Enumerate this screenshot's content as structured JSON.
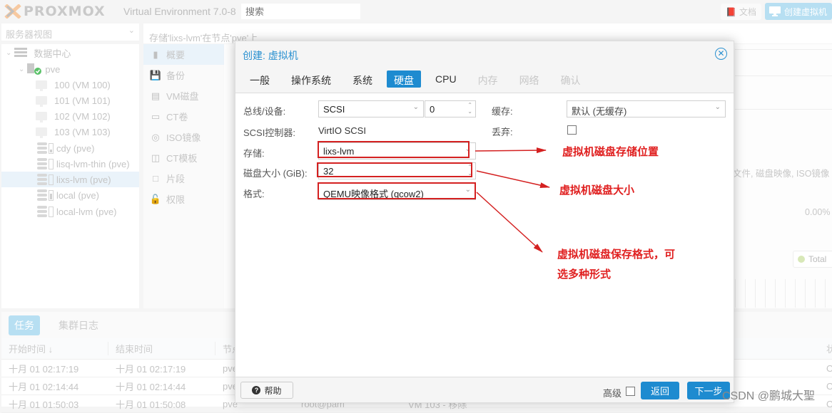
{
  "header": {
    "logo_text": "PROXMOX",
    "version": "Virtual Environment 7.0-8",
    "search_placeholder": "搜索",
    "docs_label": "文档",
    "create_vm_label": "创建虚拟机"
  },
  "tree": {
    "view_select": "服务器视图",
    "items": [
      {
        "label": "数据中心",
        "icon": "datacenter-icon"
      },
      {
        "label": "pve",
        "icon": "node-online-icon"
      },
      {
        "label": "100 (VM 100)",
        "icon": "vm-icon"
      },
      {
        "label": "101 (VM 101)",
        "icon": "vm-icon"
      },
      {
        "label": "102 (VM 102)",
        "icon": "vm-icon"
      },
      {
        "label": "103 (VM 103)",
        "icon": "vm-icon"
      },
      {
        "label": "cdy (pve)",
        "icon": "storage-icon",
        "usage": 0.3
      },
      {
        "label": "lisq-lvm-thin (pve)",
        "icon": "storage-icon",
        "usage": 0
      },
      {
        "label": "lixs-lvm (pve)",
        "icon": "storage-icon",
        "usage": 0,
        "selected": true
      },
      {
        "label": "local (pve)",
        "icon": "storage-icon",
        "usage": 0.6
      },
      {
        "label": "local-lvm (pve)",
        "icon": "storage-icon",
        "usage": 0
      }
    ]
  },
  "breadcrumb": "存储'lixs-lvm'在节点'pve'上",
  "subnav": [
    {
      "label": "概要",
      "icon": "book-icon",
      "active": true
    },
    {
      "label": "备份",
      "icon": "floppy-icon"
    },
    {
      "label": "VM磁盘",
      "icon": "hdd-icon"
    },
    {
      "label": "CT卷",
      "icon": "ct-volume-icon"
    },
    {
      "label": "ISO镜像",
      "icon": "cdrom-icon"
    },
    {
      "label": "CT模板",
      "icon": "ct-template-icon"
    },
    {
      "label": "片段",
      "icon": "snippet-file-icon"
    },
    {
      "label": "权限",
      "icon": "unlock-icon"
    }
  ],
  "background": {
    "content_text": "文件, 磁盘映像, ISO镜像",
    "usage_percent": "0.00%",
    "legend_total": "Total"
  },
  "tasks": {
    "tabs": [
      {
        "label": "任务",
        "active": true
      },
      {
        "label": "集群日志"
      }
    ],
    "columns": [
      "开始时间 ↓",
      "结束时间",
      "节点",
      "状态"
    ],
    "rows": [
      {
        "start": "十月 01 02:17:19",
        "end": "十月 01 02:17:19",
        "node": "pve",
        "status": "OK"
      },
      {
        "start": "十月 01 02:14:44",
        "end": "十月 01 02:14:44",
        "node": "pve",
        "status": "OK"
      },
      {
        "start": "十月 01 01:50:03",
        "end": "十月 01 01:50:08",
        "node": "pve",
        "user": "root@pam",
        "desc": "VM 103 - 移除",
        "status": "OK"
      }
    ]
  },
  "dialog": {
    "title": "创建: 虚拟机",
    "tabs": [
      {
        "label": "一般",
        "state": "normal"
      },
      {
        "label": "操作系统",
        "state": "normal"
      },
      {
        "label": "系统",
        "state": "normal"
      },
      {
        "label": "硬盘",
        "state": "active"
      },
      {
        "label": "CPU",
        "state": "normal"
      },
      {
        "label": "内存",
        "state": "disabled"
      },
      {
        "label": "网络",
        "state": "disabled"
      },
      {
        "label": "确认",
        "state": "disabled"
      }
    ],
    "fields": {
      "bus_label": "总线/设备:",
      "bus_value": "SCSI",
      "device_value": "0",
      "controller_label": "SCSI控制器:",
      "controller_value": "VirtIO SCSI",
      "storage_label": "存储:",
      "storage_value": "lixs-lvm",
      "size_label": "磁盘大小 (GiB):",
      "size_value": "32",
      "format_label": "格式:",
      "format_value": "QEMU映像格式 (qcow2)",
      "cache_label": "缓存:",
      "cache_value": "默认 (无缓存)",
      "discard_label": "丢弃:",
      "discard_checked": false
    },
    "footer": {
      "help_label": "帮助",
      "advanced_label": "高级",
      "advanced_checked": false,
      "back_label": "返回",
      "next_label": "下一步"
    }
  },
  "annotations": {
    "storage_note": "虚拟机磁盘存储位置",
    "size_note": "虚拟机磁盘大小",
    "format_note_line1": "虚拟机磁盘保存格式，可",
    "format_note_line2": "选多种形式",
    "color": "#e02020"
  },
  "watermark": "CSDN @鹏城大聖"
}
